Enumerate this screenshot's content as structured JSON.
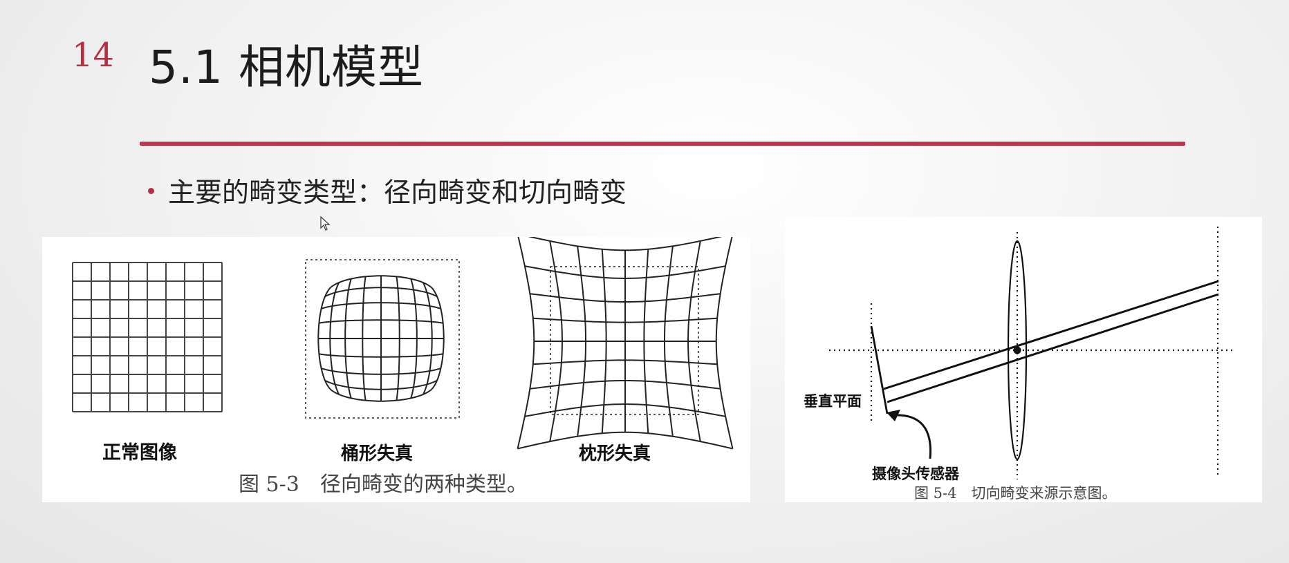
{
  "slide": {
    "number": "14",
    "title": "5.1 相机模型",
    "accent_color": "#c0334b"
  },
  "bullets": [
    {
      "text": "主要的畸变类型：径向畸变和切向畸变"
    }
  ],
  "figure_radial": {
    "labels": [
      "正常图像",
      "桶形失真",
      "枕形失真"
    ],
    "caption": "图 5-3　径向畸变的两种类型。"
  },
  "figure_tangential": {
    "label_plane": "垂直平面",
    "label_sensor": "摄像头传感器",
    "caption": "图 5-4　切向畸变来源示意图。"
  },
  "icons": {
    "cursor": "mouse-pointer-icon"
  }
}
